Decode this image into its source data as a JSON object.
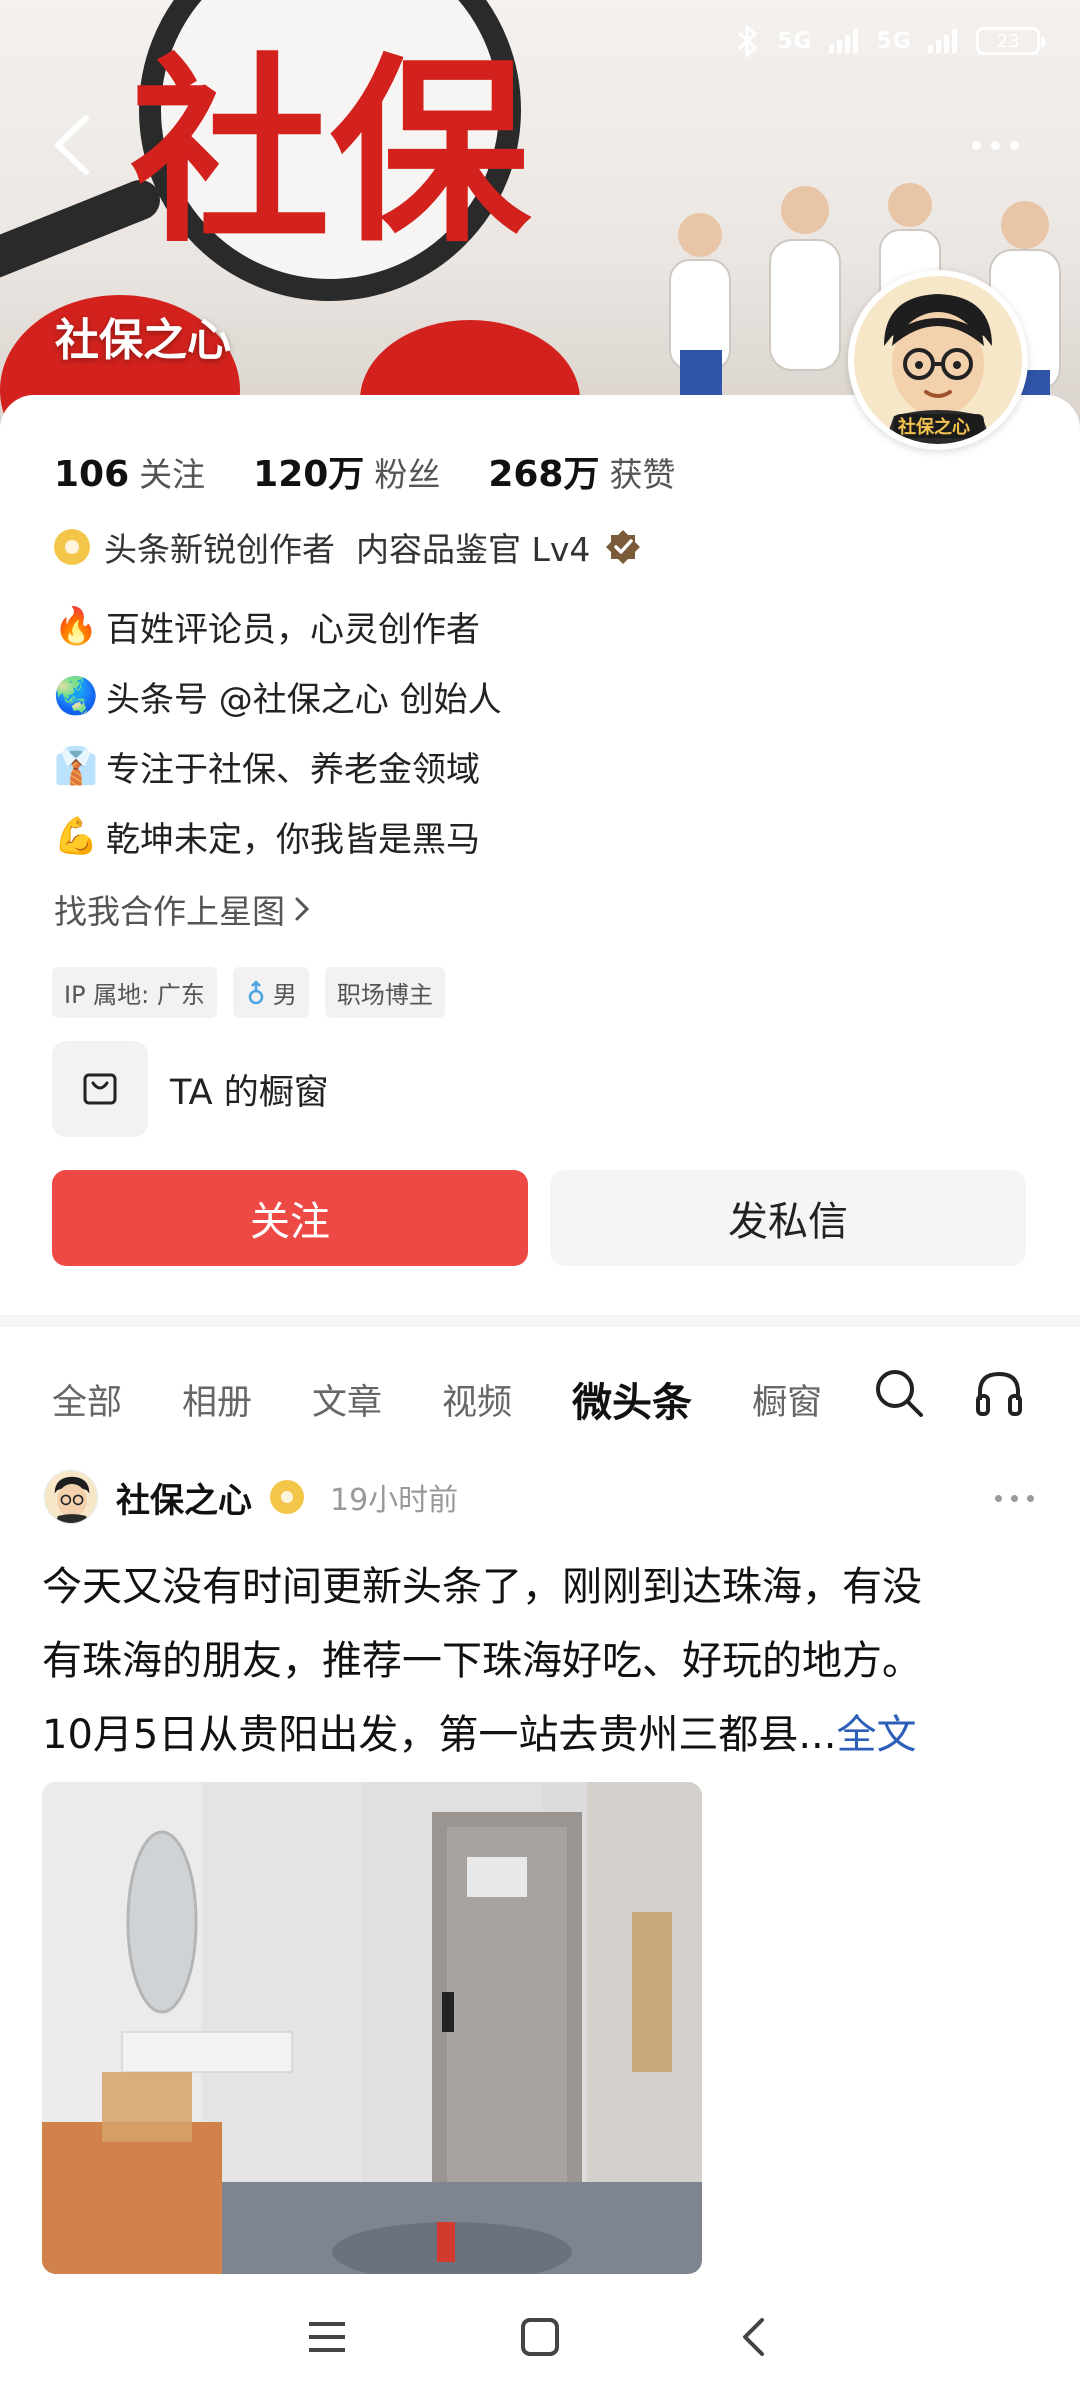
{
  "banner": {
    "title": "社保之心",
    "art_text": "社保"
  },
  "status_bar": {
    "signal_1": "5G",
    "signal_2": "5G",
    "battery": "23"
  },
  "profile": {
    "stats": [
      {
        "num": "106",
        "label": "关注"
      },
      {
        "num": "120万",
        "label": "粉丝"
      },
      {
        "num": "268万",
        "label": "获赞"
      }
    ],
    "certification": "头条新锐创作者  内容品鉴官 Lv4",
    "bio": [
      {
        "emoji": "🔥",
        "text": "百姓评论员，心灵创作者"
      },
      {
        "emoji": "🌏",
        "text": "头条号 @社保之心 创始人"
      },
      {
        "emoji": "👔",
        "text": "专注于社保、养老金领域"
      },
      {
        "emoji": "💪",
        "text": "乾坤未定，你我皆是黑马"
      }
    ],
    "cooperation": "找我合作上星图",
    "tags": [
      "IP 属地: 广东",
      "男",
      "职场博主"
    ],
    "shop_label": "TA 的橱窗",
    "avatar_caption": "社保之心",
    "follow_button": "关注",
    "message_button": "发私信"
  },
  "tabs": [
    "全部",
    "相册",
    "文章",
    "视频",
    "微头条",
    "橱窗"
  ],
  "post": {
    "author": "社保之心",
    "time": "19小时前",
    "text_line1": "今天又没有时间更新头条了，刚刚到达珠海，有没",
    "text_line2": "有珠海的朋友，推荐一下珠海好吃、好玩的地方。",
    "text_line3": "10月5日从贵阳出发，第一站去贵州三都县...",
    "more_link": "全文"
  },
  "colors": {
    "accent_red": "#ed4a46",
    "link_blue": "#2d5fb8",
    "badge_gold": "#f3c64a"
  },
  "icons": {
    "back": "back-arrow-icon",
    "more": "more-dots-icon",
    "search": "search-icon",
    "listen": "headphones-icon",
    "shop": "shopping-bag-icon",
    "nav_menu": "menu-icon",
    "nav_home": "home-square-icon",
    "nav_back": "back-chevron-icon"
  }
}
